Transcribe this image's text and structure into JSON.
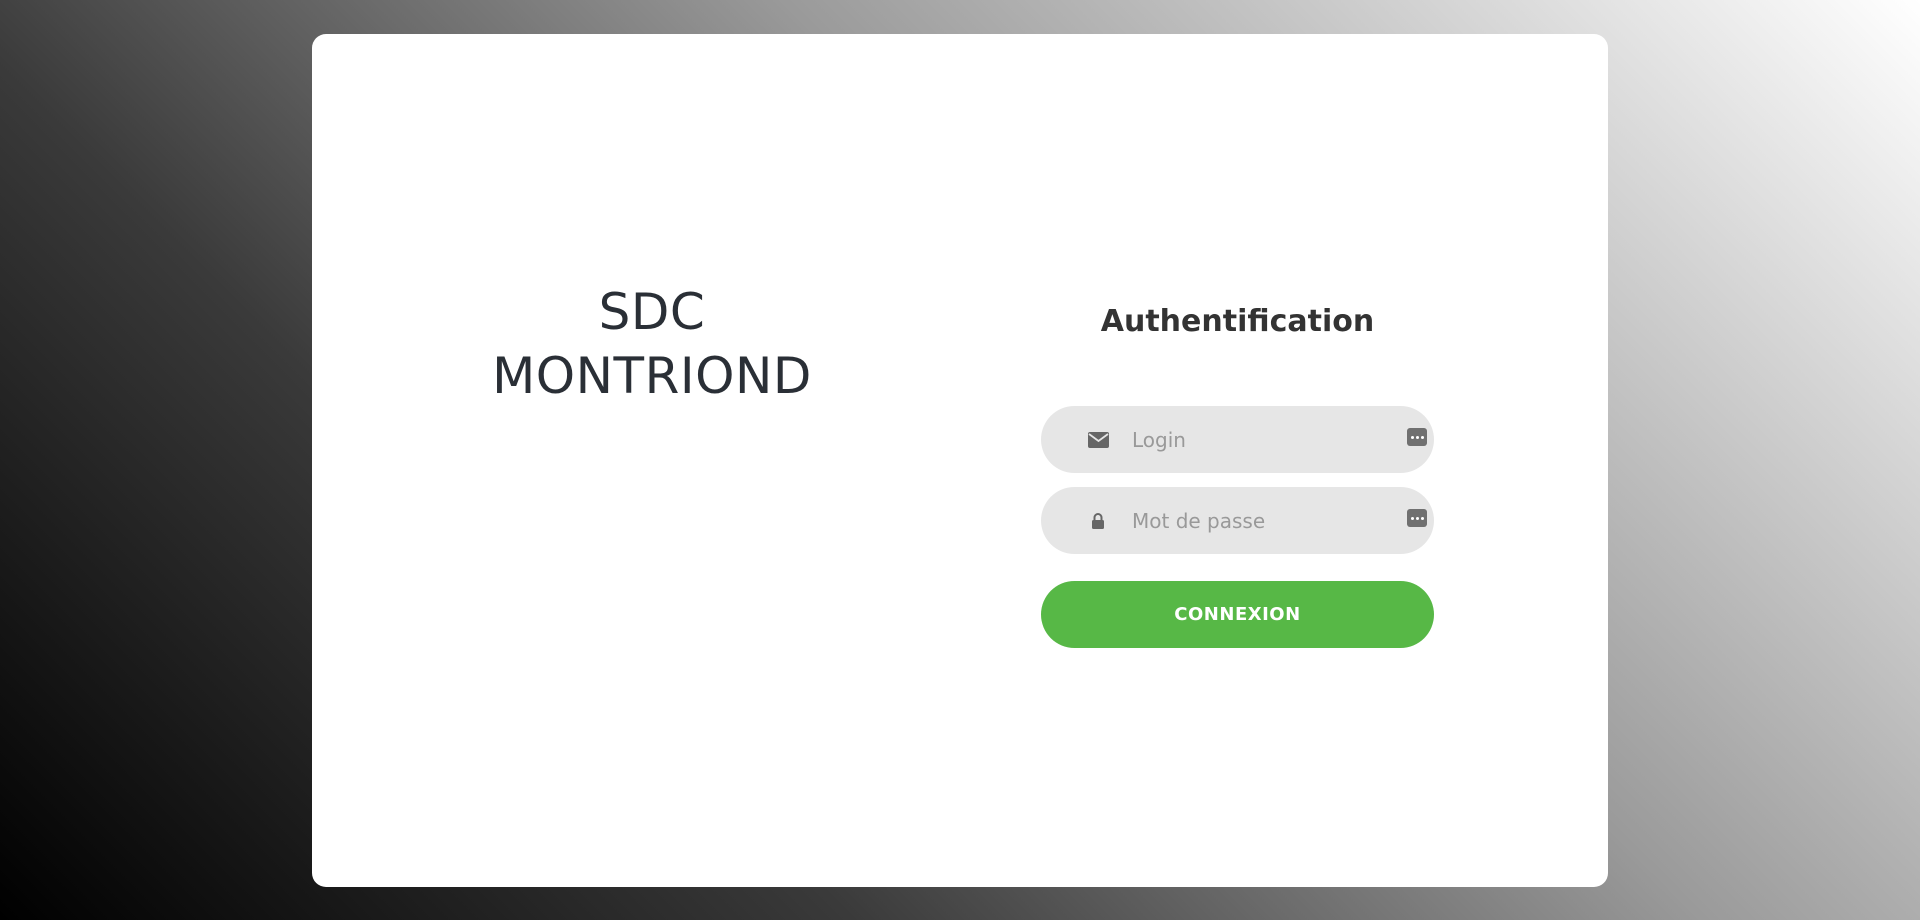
{
  "brand": {
    "line1": "SDC",
    "line2": "MONTRIOND"
  },
  "form": {
    "title": "Authentification",
    "login": {
      "placeholder": "Login",
      "value": "",
      "icon": "envelope-icon"
    },
    "password": {
      "placeholder": "Mot de passe",
      "value": "",
      "icon": "lock-icon"
    },
    "submit_label": "CONNEXION"
  },
  "colors": {
    "accent": "#57b846",
    "field_bg": "#e6e6e6",
    "title_text": "#333333",
    "brand_text": "#2a2f36"
  }
}
